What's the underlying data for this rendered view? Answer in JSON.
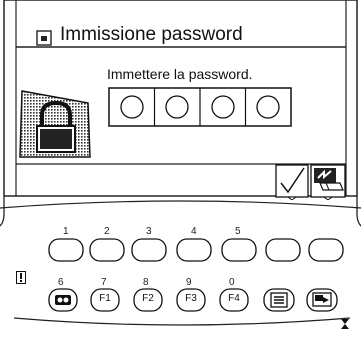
{
  "dialog": {
    "title": "Immissione password",
    "prompt": "Immettere la password.",
    "password_boxes": [
      "",
      "",
      "",
      ""
    ]
  },
  "softkeys": [
    {
      "name": "confirm",
      "icon": "checkmark-icon"
    },
    {
      "name": "cancel",
      "icon": "delete-eraser-icon"
    }
  ],
  "keypad": {
    "top_row_numbers": [
      "1",
      "2",
      "3",
      "4",
      "5",
      "",
      ""
    ],
    "bottom_row_numbers": [
      "6",
      "7",
      "8",
      "9",
      "0",
      "",
      ""
    ],
    "bottom_row_labels": [
      "",
      "F1",
      "F2",
      "F3",
      "F4",
      "",
      ""
    ]
  }
}
